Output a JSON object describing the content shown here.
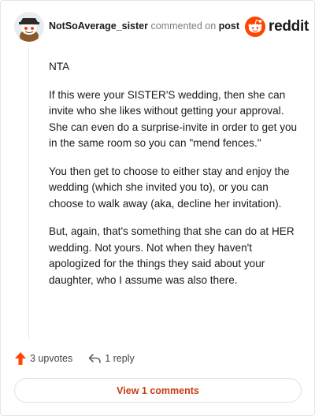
{
  "comment": {
    "username": "NotSoAverage_sister",
    "action_text": "commented on",
    "target_text": "post",
    "brand": "reddit",
    "paragraphs": [
      "NTA",
      "If this were your SISTER'S wedding, then she can invite who she likes without getting your approval. She can even do a surprise-invite in order to get you in the same room so you can \"mend fences.\"",
      "You then get to choose to either stay and enjoy the wedding (which she invited you to), or you can choose to walk away (aka, decline her invitation).",
      "But, again, that's something that she can do at HER wedding. Not yours. Not when they haven't apologized for the things they said about your daughter, who I assume was also there."
    ],
    "upvotes_label": "3 upvotes",
    "reply_label": "1 reply",
    "view_comments_label": "View 1 comments"
  },
  "colors": {
    "brand": "#ff4500",
    "upvote": "#ff4500",
    "view_button_text": "#c63e12"
  },
  "icons": {
    "avatar": "snoo-avatar-icon",
    "logo": "reddit-snoo-icon",
    "upvote": "upvote-arrow-icon",
    "reply": "reply-arrow-icon"
  }
}
